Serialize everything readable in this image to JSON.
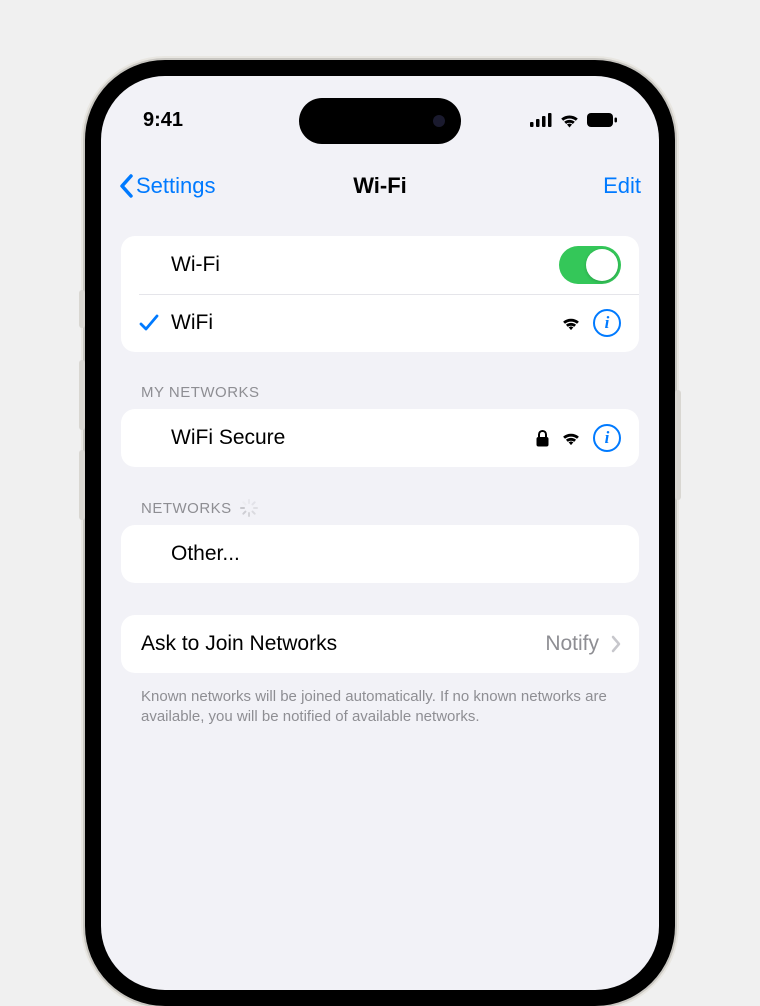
{
  "status_bar": {
    "time": "9:41"
  },
  "nav": {
    "back_label": "Settings",
    "title": "Wi-Fi",
    "edit_label": "Edit"
  },
  "wifi_toggle": {
    "label": "Wi-Fi",
    "on": true
  },
  "connected_network": {
    "name": "WiFi"
  },
  "sections": {
    "my_networks": {
      "header": "MY NETWORKS",
      "items": [
        {
          "name": "WiFi Secure",
          "secured": true
        }
      ]
    },
    "other_networks": {
      "header": "NETWORKS",
      "other_label": "Other..."
    }
  },
  "ask_to_join": {
    "label": "Ask to Join Networks",
    "value": "Notify",
    "footer": "Known networks will be joined automatically. If no known networks are available, you will be notified of available networks."
  },
  "colors": {
    "accent": "#007aff",
    "toggle_on": "#34c759",
    "bg": "#f2f2f7"
  }
}
